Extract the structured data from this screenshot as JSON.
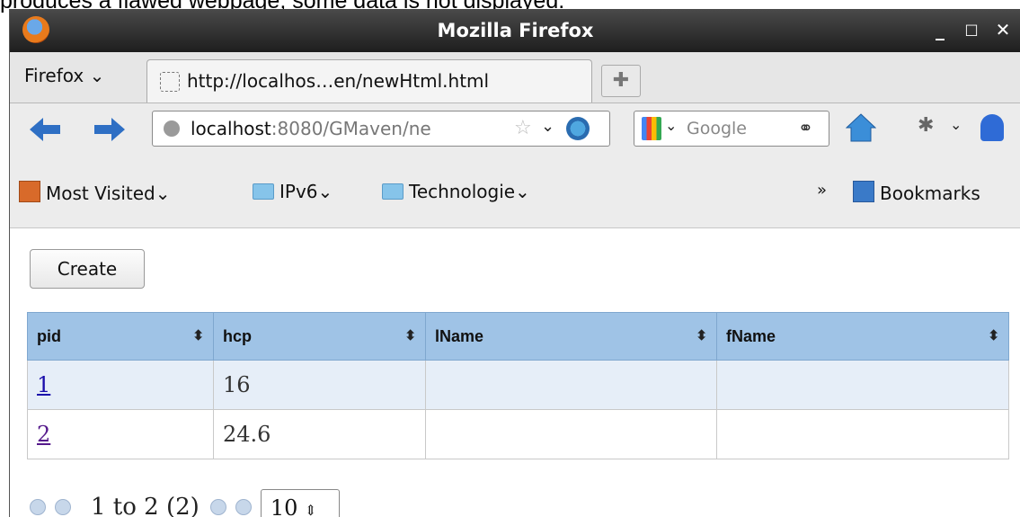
{
  "caption": "produces a flawed webpage, some data is not displayed.",
  "window": {
    "title": "Mozilla Firefox",
    "minimize": "_",
    "maximize": "□",
    "close": "✕"
  },
  "tabs": {
    "menu_label": "Firefox",
    "menu_arrow": "⌄",
    "active_tab": "http://localhos…en/newHtml.html",
    "new_tab": "✚"
  },
  "navbar": {
    "url_host": "localhost",
    "url_rest": ":8080/GMaven/ne",
    "star": "☆",
    "dropdown": "⌄",
    "search_placeholder": "Google",
    "search_dropdown": "⌄",
    "binoculars": "⚭",
    "bug": "✱",
    "bug_dropdown": "⌄"
  },
  "bookmarks": {
    "most_visited": "Most Visited⌄",
    "ipv6": "IPv6⌄",
    "technologie": "Technologie⌄",
    "overflow": "»",
    "bookmarks": "Bookmarks"
  },
  "page": {
    "create_label": "Create",
    "columns": [
      "pid",
      "hcp",
      "lName",
      "fName"
    ],
    "sort_icon": "⬍",
    "rows": [
      {
        "pid": "1",
        "hcp": "16",
        "lName": "",
        "fName": ""
      },
      {
        "pid": "2",
        "hcp": "24.6",
        "lName": "",
        "fName": ""
      }
    ],
    "pager_text": "1 to 2 (2)",
    "page_size": "10",
    "page_size_arrow": "⇕"
  }
}
